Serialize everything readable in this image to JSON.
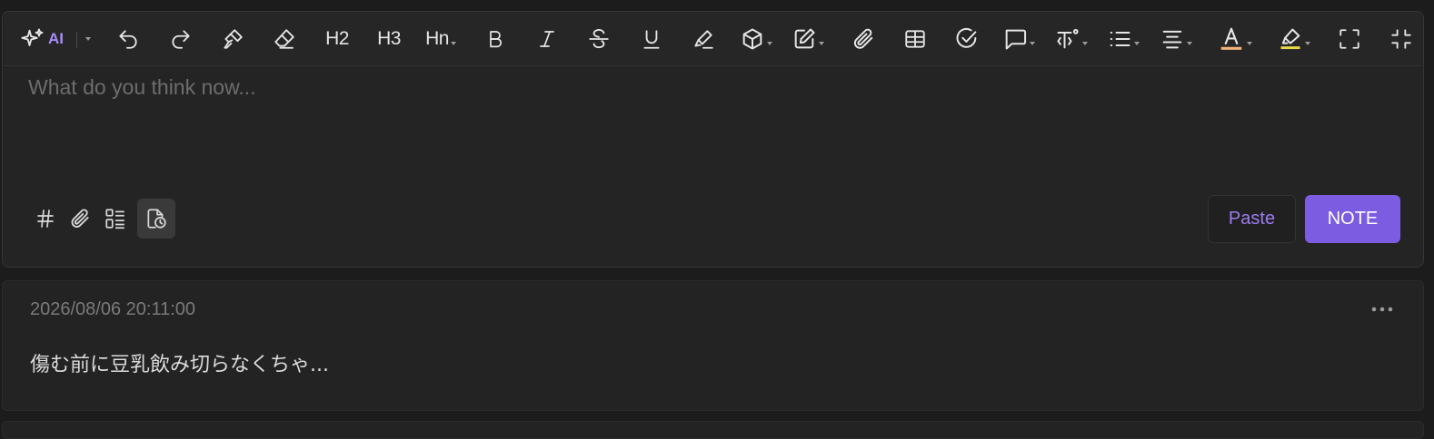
{
  "toolbar": {
    "ai_label": "AI",
    "h2": "H2",
    "h3": "H3",
    "hn": "Hn",
    "items": [
      "ai-sparkle-icon",
      "undo-icon",
      "redo-icon",
      "format-painter-icon",
      "eraser-icon",
      "heading-2",
      "heading-3",
      "heading-n",
      "bold-icon",
      "italic-icon",
      "strikethrough-icon",
      "underline-icon",
      "clear-highlight-icon",
      "block-icon",
      "edit-icon",
      "attachment-icon",
      "table-icon",
      "task-icon",
      "comment-icon",
      "text-style-icon",
      "list-icon",
      "align-icon",
      "font-color-icon",
      "highlight-color-icon",
      "fullscreen-icon",
      "exit-fullscreen-icon"
    ],
    "font_color_accent": "#f2b27a",
    "highlight_accent": "#e8d94a"
  },
  "editor": {
    "placeholder": "What do you think now...",
    "paste_label": "Paste",
    "note_label": "NOTE",
    "bottom_tools": [
      "hashtag-icon",
      "attachment-icon",
      "checklist-icon",
      "history-doc-icon"
    ],
    "accent": "#7c5ce0"
  },
  "memo": {
    "timestamp": "2026/08/06 20:11:00",
    "text": "傷む前に豆乳飲み切らなくちゃ..."
  }
}
